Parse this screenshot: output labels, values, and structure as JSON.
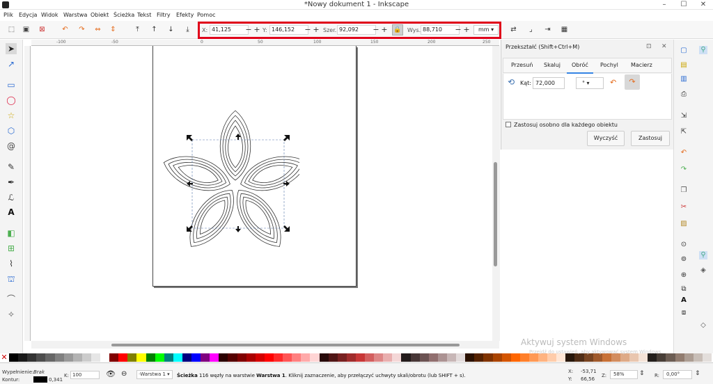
{
  "window": {
    "title": "*Nowy dokument 1 - Inkscape",
    "min": "–",
    "max": "☐",
    "close": "✕"
  },
  "menu": [
    "Plik",
    "Edycja",
    "Widok",
    "Warstwa",
    "Obiekt",
    "Ścieżka",
    "Tekst",
    "Filtry",
    "Efekty",
    "Pomoc"
  ],
  "toolbar": {
    "x_label": "X:",
    "x_value": "41,125",
    "y_label": "Y:",
    "y_value": "146,152",
    "w_label": "Szer.:",
    "w_value": "92,092",
    "h_label": "Wys.:",
    "h_value": "88,710",
    "unit": "mm",
    "minus": "−",
    "plus": "+"
  },
  "ruler": {
    "m100": "-100",
    "m50": "-50",
    "z": "0",
    "p50": "50",
    "p100": "100",
    "p150": "150",
    "p200": "200",
    "p250": "250"
  },
  "transform": {
    "title": "Przekształć (Shift+Ctrl+M)",
    "tabs": [
      "Przesuń",
      "Skaluj",
      "Obróć",
      "Pochyl",
      "Macierz"
    ],
    "active_tab": "Obróć",
    "angle_label": "Kąt:",
    "angle_value": "72,000",
    "unit_value": "°",
    "checkbox_label": "Zastosuj osobno dla każdego obiektu",
    "clear_button": "Wyczyść",
    "apply_button": "Zastosuj"
  },
  "status": {
    "fill_label": "Wypełnienie:",
    "fill_value": "Brak",
    "stroke_label": "Kontur:",
    "stroke_width": "0,341",
    "opacity_label": "K:",
    "opacity_value": "100",
    "layer": "·Warstwa 1",
    "msg_bold1": "Ścieżka",
    "msg_mid": " 116 węzły na warstwie ",
    "msg_bold2": "Warstwa 1",
    "msg_tail": ". Kliknij zaznaczenie, aby przełączyć uchwyty skali/obrotu (lub SHIFT + s).",
    "x_label": "X:",
    "x_value": "-53,71",
    "y_label": "Y:",
    "y_value": "66,56",
    "z_label": "Z:",
    "zoom": "58%",
    "r_label": "R:",
    "rotation": "0,00°"
  },
  "watermark": {
    "title": "Aktywuj system Windows",
    "sub": "Przejdź do ustawień, aby aktywować system Windows."
  },
  "colors": {
    "accent_red": "#e0001a",
    "tab_blue": "#3584e4",
    "orange": "#e46a1b",
    "green": "#4caf50"
  },
  "palette": [
    "#000000",
    "#1a1a1a",
    "#333333",
    "#4d4d4d",
    "#666666",
    "#808080",
    "#999999",
    "#b3b3b3",
    "#cccccc",
    "#e6e6e6",
    "#ffffff",
    "#800000",
    "#ff0000",
    "#808000",
    "#ffff00",
    "#008000",
    "#00ff00",
    "#008080",
    "#00ffff",
    "#000080",
    "#0000ff",
    "#800080",
    "#ff00ff",
    "#2b0000",
    "#550000",
    "#800000",
    "#aa0000",
    "#d40000",
    "#ff0000",
    "#ff2a2a",
    "#ff5555",
    "#ff8080",
    "#ffaaaa",
    "#ffd5d5",
    "#280b0b",
    "#501616",
    "#782121",
    "#a02c2c",
    "#c83737",
    "#d35f5f",
    "#de8787",
    "#e9afaf",
    "#f4d7d7",
    "#241c1c",
    "#483737",
    "#6c5353",
    "#916f6f",
    "#ac9393",
    "#c8b7b7",
    "#e3dbdb",
    "#2b1100",
    "#552200",
    "#803300",
    "#aa4400",
    "#d45500",
    "#ff6600",
    "#ff7f2a",
    "#ff9955",
    "#ffb380",
    "#ffccaa",
    "#ffe6d5",
    "#28170b",
    "#502d16",
    "#784421",
    "#a05a2c",
    "#c87137",
    "#d38d5f",
    "#deaa87",
    "#e9c6af",
    "#f4e3d7",
    "#241f1c",
    "#483e37",
    "#6c5d53",
    "#917c6f",
    "#ac9d93",
    "#c8beb7",
    "#e3dedb"
  ]
}
